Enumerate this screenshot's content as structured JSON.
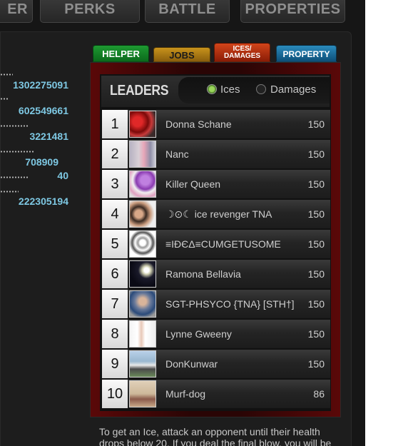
{
  "nav": {
    "items": [
      {
        "label": "ER"
      },
      {
        "label": "PERKS"
      },
      {
        "label": "BATTLE"
      },
      {
        "label": "PROPERTIES"
      }
    ]
  },
  "stats": [
    {
      "value": "1302275091"
    },
    {
      "value": "602549661"
    },
    {
      "value": "3221481"
    },
    {
      "value": "708909"
    },
    {
      "value": "40"
    },
    {
      "value": "222305194"
    }
  ],
  "tabs": {
    "helper": "HELPER",
    "jobs": "JOBS",
    "ices_line1": "ICES/",
    "ices_line2": "DAMAGES",
    "property": "PROPERTY"
  },
  "leaders": {
    "title": "LEADERS",
    "options": [
      {
        "label": "Ices",
        "checked": true
      },
      {
        "label": "Damages",
        "checked": false
      }
    ],
    "rows": [
      {
        "rank": "1",
        "name": "Donna Schane",
        "score": "150",
        "avatar_icon": "avatar-strawberries"
      },
      {
        "rank": "2",
        "name": "Nanc",
        "score": "150",
        "avatar_icon": "avatar-woman"
      },
      {
        "rank": "3",
        "name": "Killer Queen",
        "score": "150",
        "avatar_icon": "avatar-flowers"
      },
      {
        "rank": "4",
        "name": "☽⊙☾ ice revenger TNA",
        "score": "150",
        "avatar_icon": "avatar-couple"
      },
      {
        "rank": "5",
        "name": "≡IÐЄΔ≡CUMGETUSOME",
        "score": "150",
        "avatar_icon": "avatar-sketch"
      },
      {
        "rank": "6",
        "name": "Ramona Bellavia",
        "score": "150",
        "avatar_icon": "avatar-moon"
      },
      {
        "rank": "7",
        "name": "SGT-PHSYCO {TNA} [STH†]",
        "score": "150",
        "avatar_icon": "avatar-man"
      },
      {
        "rank": "8",
        "name": "Lynne Gweeny",
        "score": "150",
        "avatar_icon": "avatar-dress"
      },
      {
        "rank": "9",
        "name": "DonKunwar",
        "score": "150",
        "avatar_icon": "avatar-car"
      },
      {
        "rank": "10",
        "name": "Murf-dog",
        "score": "86",
        "avatar_icon": "avatar-people"
      }
    ]
  },
  "info": {
    "text": "To get an Ice, attack an opponent until their health drops below 20. If you deal the final blow, you will be"
  },
  "colors": {
    "stat_value": "#7ec8e3",
    "tab_helper": "#1e9a32",
    "tab_jobs": "#c8931c",
    "tab_ices": "#d2451a",
    "tab_property": "#2b8bbd",
    "radio_checked": "#9ad65a"
  }
}
